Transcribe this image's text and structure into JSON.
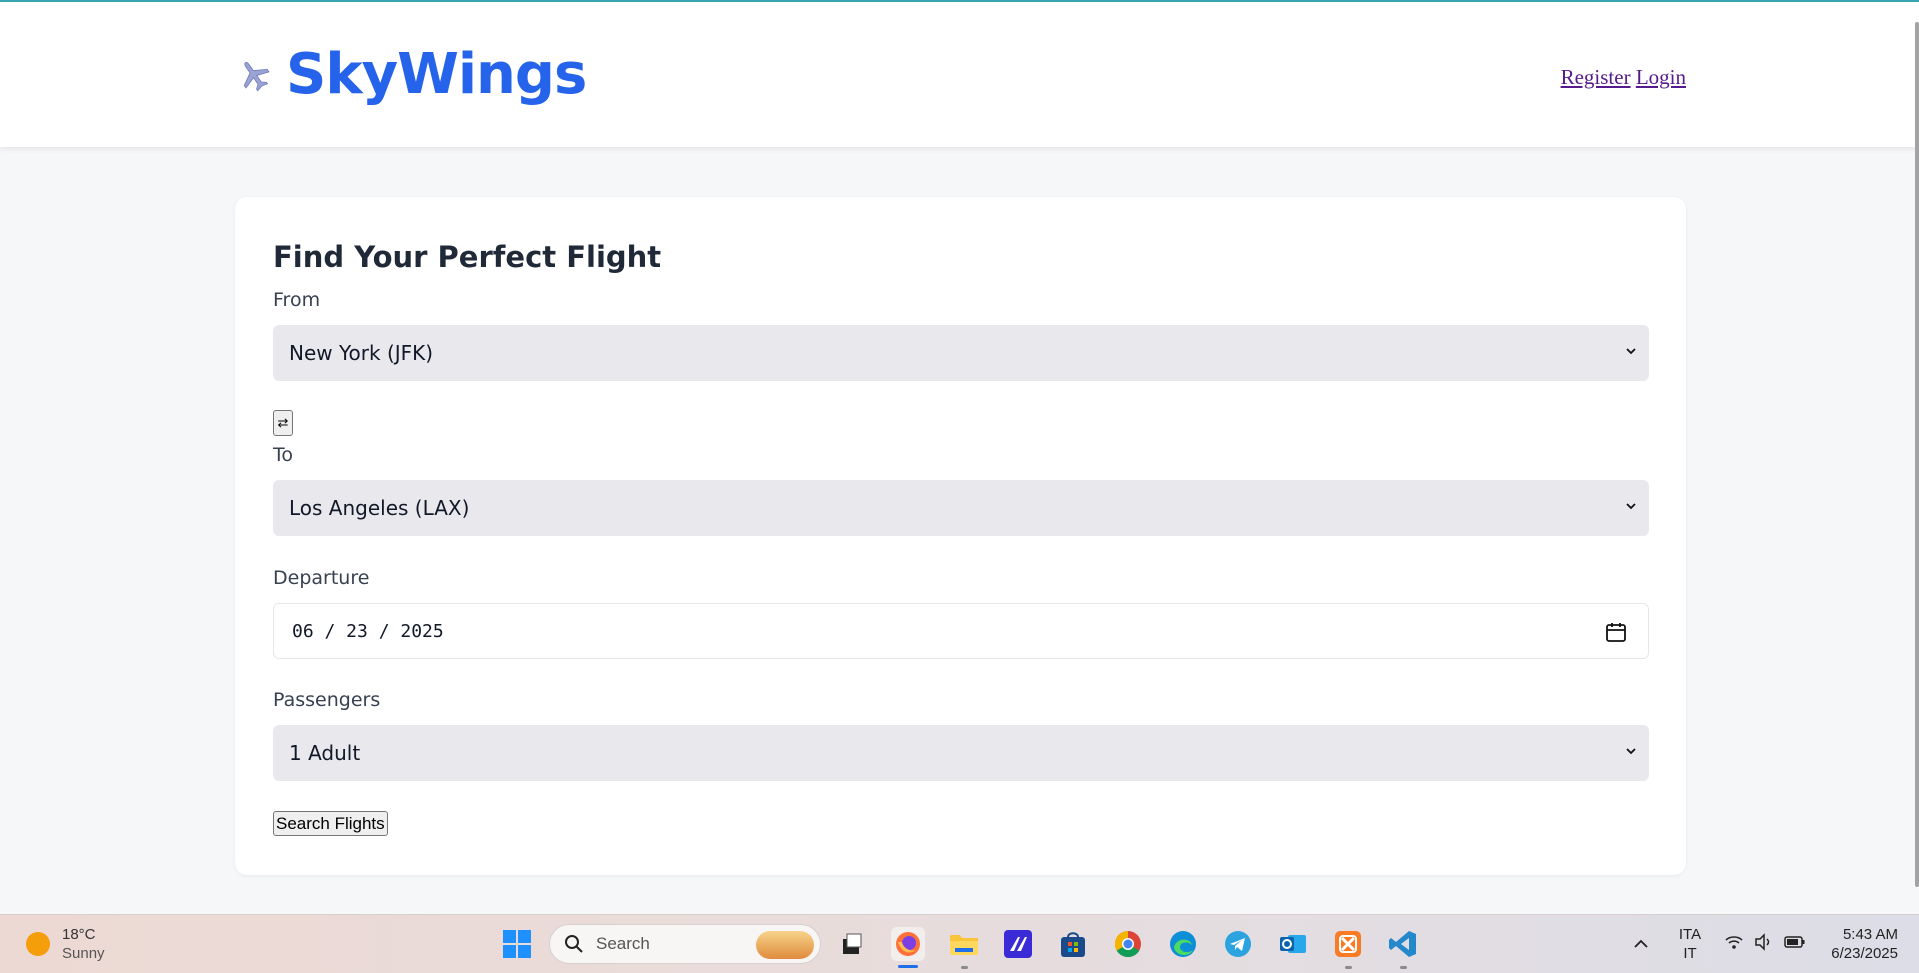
{
  "header": {
    "brand": "SkyWings",
    "register_label": "Register",
    "login_label": "Login"
  },
  "form": {
    "title": "Find Your Perfect Flight",
    "from_label": "From",
    "from_value": "New York (JFK)",
    "swap_label": "⇄",
    "to_label": "To",
    "to_value": "Los Angeles (LAX)",
    "departure_label": "Departure",
    "departure_value": "06 / 23 / 2025",
    "passengers_label": "Passengers",
    "passengers_value": "1 Adult",
    "search_label": "Search Flights"
  },
  "taskbar": {
    "temperature": "18°C",
    "condition": "Sunny",
    "search_placeholder": "Search",
    "language_top": "ITA",
    "language_bottom": "IT",
    "time": "5:43 AM",
    "date": "6/23/2025",
    "apps": [
      "start-icon",
      "search-icon",
      "task-view-icon",
      "firefox-icon",
      "file-explorer-icon",
      "visual-studio-icon",
      "microsoft-store-icon",
      "chrome-icon",
      "edge-icon",
      "telegram-icon",
      "outlook-icon",
      "xampp-icon",
      "vscode-icon"
    ]
  },
  "colors": {
    "brand": "#2563eb",
    "select_bg": "#e8e8ed",
    "link": "#551a8b"
  }
}
